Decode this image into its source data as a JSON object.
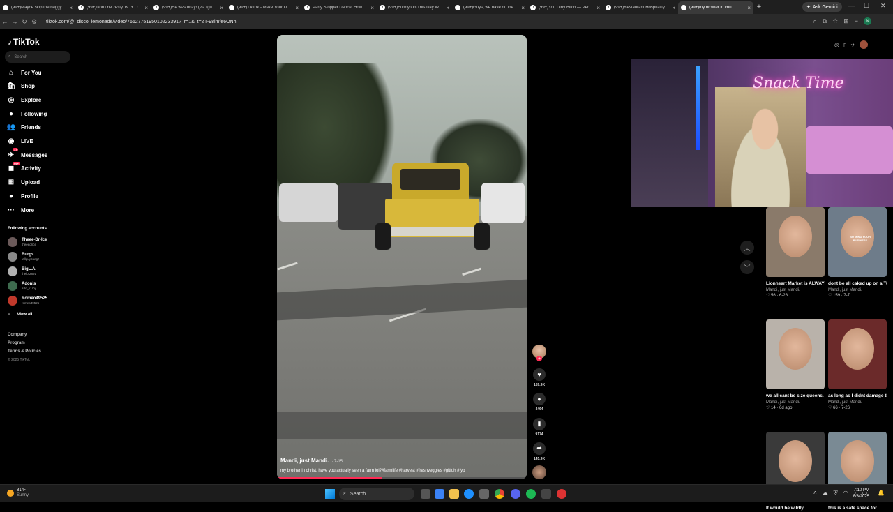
{
  "browser": {
    "tabs": [
      {
        "title": "(99+)Maybe skip the baggy",
        "active": false
      },
      {
        "title": "(99+)Don't be zesty. BUY O",
        "active": false
      },
      {
        "title": "(99+)He was okay! (via rgu",
        "active": false
      },
      {
        "title": "(99+)TikTok - Make Your D",
        "active": false
      },
      {
        "title": "Party Stopper Dance: How",
        "active": false
      },
      {
        "title": "(99+)Funny On This Day W",
        "active": false
      },
      {
        "title": "(99+)Guys, we have no ide",
        "active": false
      },
      {
        "title": "(99+)You Dirty Bitch — Per",
        "active": false
      },
      {
        "title": "(99+)Restaurant Hospitality",
        "active": false
      },
      {
        "title": "(99+)my brother in chri",
        "active": true
      }
    ],
    "new_tab": "+",
    "ask_gemini": "Ask Gemini",
    "url": "tiktok.com/@_disco_lemonade/video/7662775195010223391?_r=1&_t=ZT-98lmfe6ONh",
    "profile_initial": "N"
  },
  "tiktok": {
    "logo": "TikTok",
    "search_placeholder": "Search",
    "nav": [
      {
        "label": "For You",
        "icon": "home-icon",
        "glyph": "⌂"
      },
      {
        "label": "Shop",
        "icon": "shop-icon",
        "glyph": "🛍"
      },
      {
        "label": "Explore",
        "icon": "compass-icon",
        "glyph": "◎"
      },
      {
        "label": "Following",
        "icon": "following-icon",
        "glyph": "●"
      },
      {
        "label": "Friends",
        "icon": "friends-icon",
        "glyph": "👥"
      },
      {
        "label": "LIVE",
        "icon": "live-icon",
        "glyph": "◉"
      },
      {
        "label": "Messages",
        "icon": "messages-icon",
        "glyph": "✈",
        "badge": "17"
      },
      {
        "label": "Activity",
        "icon": "activity-icon",
        "glyph": "◼",
        "badge": "99+"
      },
      {
        "label": "Upload",
        "icon": "upload-icon",
        "glyph": "⊞"
      },
      {
        "label": "Profile",
        "icon": "profile-icon",
        "glyph": "●"
      },
      {
        "label": "More",
        "icon": "more-icon",
        "glyph": "···"
      }
    ],
    "following_header": "Following accounts",
    "following": [
      {
        "name": "Theee-Dr-Ice",
        "handle": "theeedrice",
        "color": "#6b5a5a"
      },
      {
        "name": "Burgs",
        "handle": "tallguybuegz",
        "color": "#8a8a8a"
      },
      {
        "name": "BigL.A.",
        "handle": "theiot2891",
        "color": "#b0b0b0"
      },
      {
        "name": "Adonis",
        "handle": "a3o_k1rby",
        "color": "#3e6b4e"
      },
      {
        "name": "Romeo49525",
        "handle": "romeo49525",
        "color": "#c0392b"
      }
    ],
    "view_all": "View all",
    "footer": [
      "Company",
      "Program",
      "Terms & Policies"
    ],
    "copyright": "© 2025 TikTok"
  },
  "video": {
    "author": "Mandi, just Mandi.",
    "date": "· 7-15",
    "description": "my brother in christ, have you actually seen a farm lol?#farmlife #harvest #freshveggies #gitfoh #fyp",
    "progress": 0.42,
    "actions": [
      {
        "name": "like-button",
        "icon": "heart-icon",
        "glyph": "♥",
        "count": "189.9K"
      },
      {
        "name": "comment-button",
        "icon": "comment-icon",
        "glyph": "●",
        "count": "4464"
      },
      {
        "name": "save-button",
        "icon": "bookmark-icon",
        "glyph": "▮",
        "count": "9174"
      },
      {
        "name": "share-button",
        "icon": "share-icon",
        "glyph": "➦",
        "count": "145.9K"
      }
    ]
  },
  "webcam": {
    "neon_sign": "Snack Time"
  },
  "related": [
    {
      "title": "Lionheart Market is ALWAYS accepting...",
      "author": "Mandi, just Mandi.",
      "meta": "♡ 56 · 6-28",
      "bg": "#8a7a6a"
    },
    {
      "title": "dont be all caked up on a Tuesday acting like...",
      "author": "Mandi, just Mandi.",
      "meta": "♡ 159 · 7-7",
      "bg": "#6e7c8a",
      "overlay": "BO MIND YOUR BUSINESS"
    },
    {
      "title": "we all cant be size queens. little hauls...",
      "author": "Mandi, just Mandi.",
      "meta": "♡ 14 · 6d ago",
      "bg": "#b9b2aa"
    },
    {
      "title": "as long as I didnt damage the truck he...",
      "author": "Mandi, just Mandi.",
      "meta": "♡ 66 · 7-26",
      "bg": "#6b2a2a"
    },
    {
      "title": "It would be wildly",
      "author": "",
      "meta": "",
      "bg": "#3a3a3a"
    },
    {
      "title": "this is a safe space for",
      "author": "",
      "meta": "",
      "bg": "#7a8a94"
    }
  ],
  "taskbar": {
    "weather_temp": "81°F",
    "weather_text": "Sunny",
    "search_label": "Search",
    "time": "7:10 PM",
    "date": "8/3/2025"
  }
}
